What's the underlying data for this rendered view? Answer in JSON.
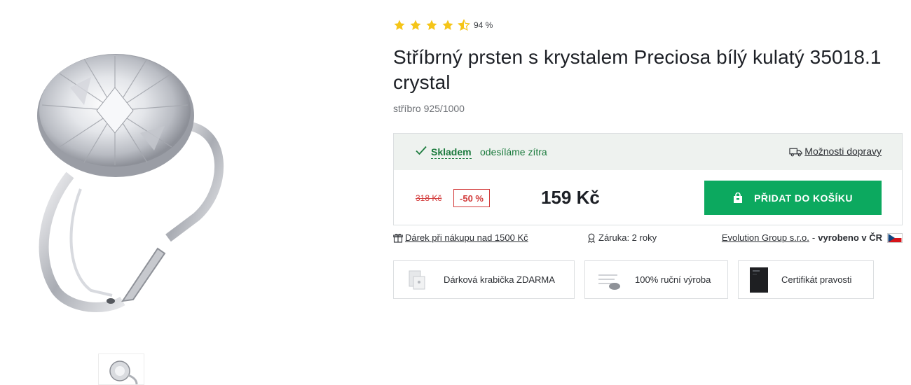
{
  "rating": {
    "stars": 4.5,
    "max_stars": 5,
    "percent": "94 %"
  },
  "product": {
    "title": "Stříbrný prsten s krystalem Preciosa bílý kulatý 35018.1 crystal",
    "subtitle": "stříbro 925/1000"
  },
  "stock": {
    "status": "Skladem",
    "note": "odesíláme zítra",
    "delivery_link": "Možnosti dopravy"
  },
  "price": {
    "old": "318 Kč",
    "discount": "-50 %",
    "current": "159 Kč",
    "add_to_cart": "PŘIDAT DO KOŠÍKU"
  },
  "meta": {
    "gift": "Dárek při nákupu nad 1500 Kč",
    "warranty": "Záruka: 2 roky",
    "maker_link": "Evolution Group s.r.o.",
    "maker_sep": "-",
    "maker_made": "vyrobeno v ČR"
  },
  "features": [
    {
      "label": "Dárková krabička ZDARMA",
      "icon": "gift-box-image"
    },
    {
      "label": "100% ruční výroba",
      "icon": "handmade-image"
    },
    {
      "label": "Certifikát pravosti",
      "icon": "certificate-image"
    }
  ],
  "colors": {
    "accent_green": "#0ca95f",
    "stock_green": "#1a7a3c",
    "sale_red": "#d23a3a",
    "star_yellow": "#f5c518"
  },
  "icons": [
    "star-icon",
    "check-icon",
    "truck-icon",
    "bag-icon",
    "gift-icon",
    "ribbon-icon",
    "czech-flag-icon"
  ]
}
